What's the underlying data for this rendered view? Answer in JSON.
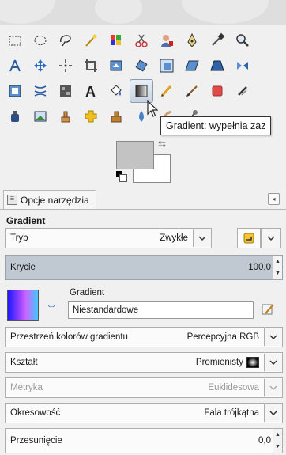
{
  "tooltip": "Gradient: wypełnia zaz",
  "tab": {
    "label": "Opcje narzędzia"
  },
  "options": {
    "title": "Gradient",
    "mode": {
      "label": "Tryb",
      "value": "Zwykłe"
    },
    "opacity": {
      "label": "Krycie",
      "value": "100,0"
    },
    "gradient": {
      "label": "Gradient",
      "name": "Niestandardowe"
    },
    "color_space": {
      "label": "Przestrzeń kolorów gradientu",
      "value": "Percepcyjna RGB"
    },
    "shape": {
      "label": "Kształt",
      "value": "Promienisty"
    },
    "metric": {
      "label": "Metryka",
      "value": "Euklidesowa"
    },
    "repeat": {
      "label": "Okresowość",
      "value": "Fala trójkątna"
    },
    "offset": {
      "label": "Przesunięcie",
      "value": "0,0"
    }
  },
  "colors": {
    "foreground": "#c3c3c3",
    "background": "#ffffff"
  },
  "tools": [
    [
      "rect-select-icon",
      "ellipse-select-icon",
      "lasso-icon",
      "fuzzy-select-icon",
      "by-color-select-icon",
      "scissors-icon",
      "foreground-select-icon",
      "paths-icon",
      "color-picker-icon",
      "zoom-icon"
    ],
    [
      "measure-icon",
      "move-icon",
      "align-icon",
      "crop-icon",
      "unified-transform-icon",
      "rotate-icon",
      "scale-icon",
      "shear-icon",
      "perspective-icon",
      "flip-icon"
    ],
    [
      "cage-transform-icon",
      "warp-icon",
      "handle-transform-icon",
      "text-icon",
      "bucket-fill-icon",
      "gradient-icon",
      "pencil-icon",
      "paintbrush-icon",
      "eraser-icon",
      "airbrush-icon"
    ],
    [
      "ink-icon",
      "mypaint-brush-icon",
      "clone-icon",
      "heal-icon",
      "perspective-clone-icon",
      "blur-icon",
      "smudge-icon",
      "dodge-burn-icon"
    ]
  ]
}
